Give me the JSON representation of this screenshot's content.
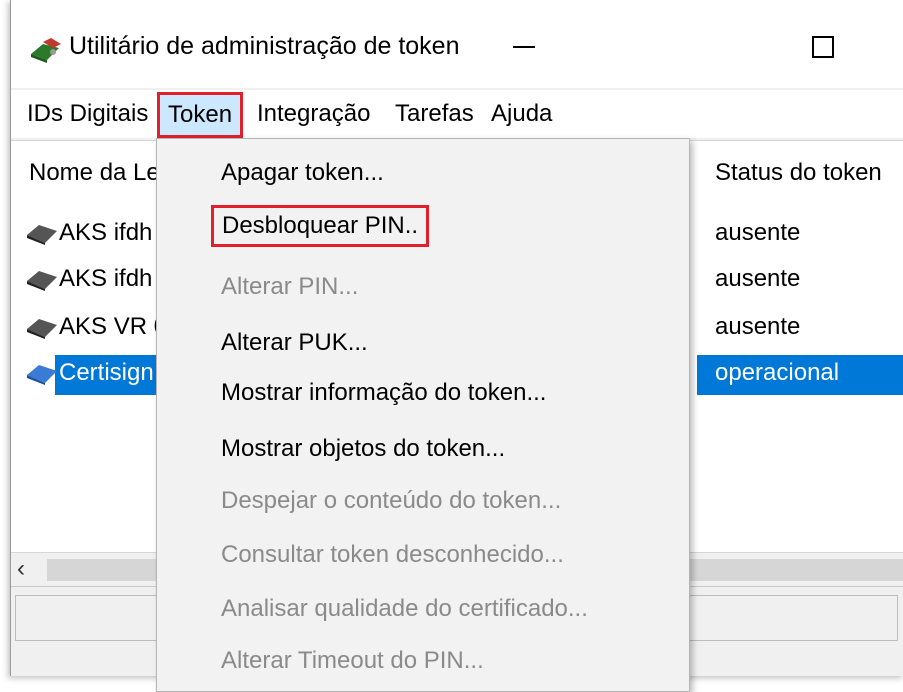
{
  "window": {
    "title": "Utilitário de administração de token"
  },
  "menubar": {
    "items": [
      "IDs Digitais",
      "Token",
      "Integração",
      "Tarefas",
      "Ajuda"
    ]
  },
  "list": {
    "columns": {
      "name": "Nome da Le",
      "status": "Status do token"
    },
    "rows": [
      {
        "name": "AKS ifdh",
        "status": "ausente"
      },
      {
        "name": "AKS ifdh",
        "status": "ausente"
      },
      {
        "name": "AKS VR 0",
        "status": "ausente"
      },
      {
        "name": "Certisign",
        "status": "operacional",
        "selected": true
      }
    ]
  },
  "scrollbar": {
    "left_arrow": "‹"
  },
  "token_menu": {
    "items": [
      {
        "label": "Apagar token...",
        "enabled": true
      },
      {
        "label": "Desbloquear PIN..",
        "enabled": true,
        "highlighted": true
      },
      {
        "label": "Alterar PIN...",
        "enabled": false
      },
      {
        "label": "Alterar PUK...",
        "enabled": true
      },
      {
        "label": "Mostrar informação do token...",
        "enabled": true
      },
      {
        "label": "Mostrar objetos do token...",
        "enabled": true
      },
      {
        "label": "Despejar o conteúdo do token...",
        "enabled": false
      },
      {
        "label": "Consultar token desconhecido...",
        "enabled": false
      },
      {
        "label": "Analisar qualidade do certificado...",
        "enabled": false
      },
      {
        "label": "Alterar Timeout do PIN...",
        "enabled": false
      }
    ]
  },
  "colors": {
    "selection": "#0078d7",
    "highlight_border": "#e0202a",
    "menu_active": "#cce8ff",
    "disabled_text": "#8a8a8a"
  }
}
